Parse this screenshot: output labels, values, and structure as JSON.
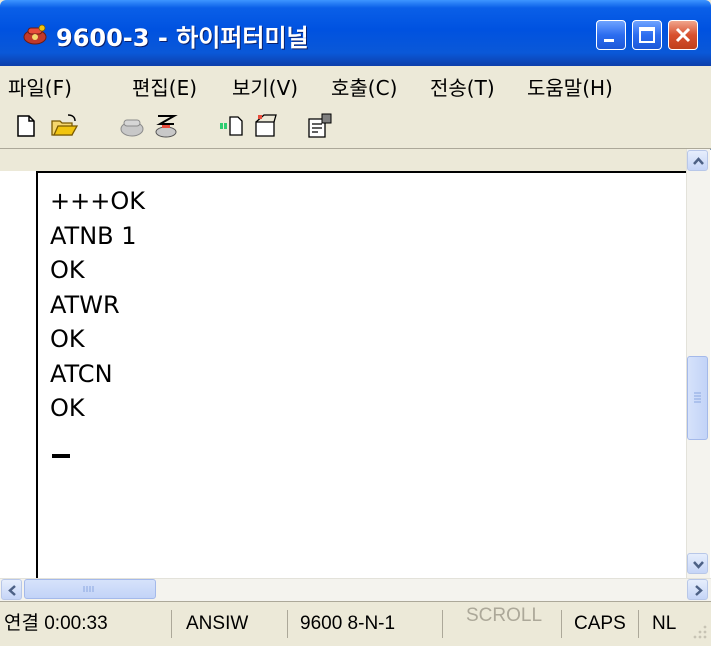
{
  "window": {
    "title": "9600-3 - 하이퍼터미널",
    "icon": "hyperterminal-phone-icon"
  },
  "menu": [
    {
      "label": "파일(F)"
    },
    {
      "label": "편집(E)"
    },
    {
      "label": "보기(V)"
    },
    {
      "label": "호출(C)"
    },
    {
      "label": "전송(T)"
    },
    {
      "label": "도움말(H)"
    }
  ],
  "toolbar": {
    "icons": [
      "new-icon",
      "open-icon",
      "connect-icon",
      "disconnect-icon",
      "send-icon",
      "receive-icon",
      "properties-icon"
    ]
  },
  "terminal": {
    "lines": [
      "+++OK",
      "ATNB 1",
      "OK",
      "ATWR",
      "OK",
      "ATCN",
      "OK"
    ]
  },
  "status": {
    "connected": "연결 0:00:33",
    "emulation": "ANSIW",
    "port": "9600 8-N-1",
    "scroll": "SCROLL",
    "caps": "CAPS",
    "num": "NL"
  },
  "colors": {
    "titlebar": "#0052e0",
    "close_button": "#d8512f",
    "chrome": "#ece9d8"
  }
}
